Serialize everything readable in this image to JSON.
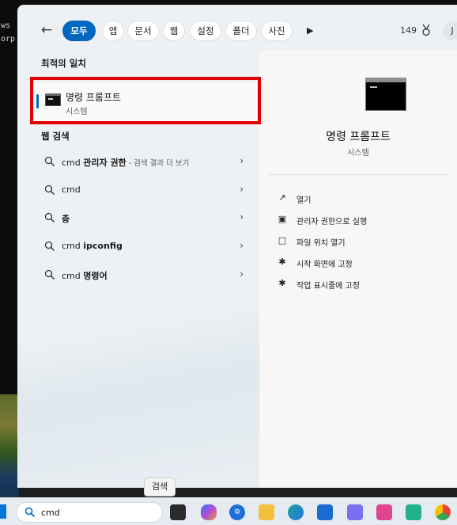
{
  "desktop": {
    "terminal_lines": [
      "ws",
      "orp"
    ]
  },
  "tabs": {
    "items": [
      {
        "label": "모두",
        "active": true
      },
      {
        "label": "앱"
      },
      {
        "label": "문서"
      },
      {
        "label": "웹"
      },
      {
        "label": "설정"
      },
      {
        "label": "폴더"
      },
      {
        "label": "사진"
      }
    ],
    "more_icon": "play-icon",
    "points_count": "149",
    "avatar_initial": "J"
  },
  "left": {
    "best_match_title": "최적의 일치",
    "best_match": {
      "name": "명령 프롬프트",
      "subtitle": "시스템"
    },
    "web_search_title": "웹 검색",
    "web_results": [
      {
        "prefix": "cmd ",
        "bold": "관리자 권한",
        "hint": " - 검색 결과 더 보기"
      },
      {
        "prefix": "cmd",
        "bold": "",
        "hint": ""
      },
      {
        "prefix": "",
        "bold": "층",
        "hint": ""
      },
      {
        "prefix": "cmd ",
        "bold": "ipconfig",
        "hint": ""
      },
      {
        "prefix": "cmd ",
        "bold": "명령어",
        "hint": ""
      }
    ]
  },
  "right": {
    "app_title": "명령 프롬프트",
    "app_subtitle": "시스템",
    "actions": [
      {
        "label": "열기",
        "icon": "open-external-icon"
      },
      {
        "label": "관리자 권한으로 실행",
        "icon": "shield-icon"
      },
      {
        "label": "파일 위치 열기",
        "icon": "folder-icon"
      },
      {
        "label": "시작 화면에 고정",
        "icon": "pin-icon"
      },
      {
        "label": "작업 표시줄에 고정",
        "icon": "pin-icon"
      }
    ]
  },
  "tooltip": "검색",
  "taskbar": {
    "search_value": "cmd",
    "pinned_icons": [
      "task-view-icon",
      "copilot-icon",
      "settings-gear-icon",
      "file-explorer-icon",
      "edge-icon",
      "store-icon",
      "app-icon",
      "app-icon",
      "app-icon",
      "chrome-icon"
    ]
  },
  "colors": {
    "accent": "#0067c0",
    "highlight": "#e00000"
  }
}
